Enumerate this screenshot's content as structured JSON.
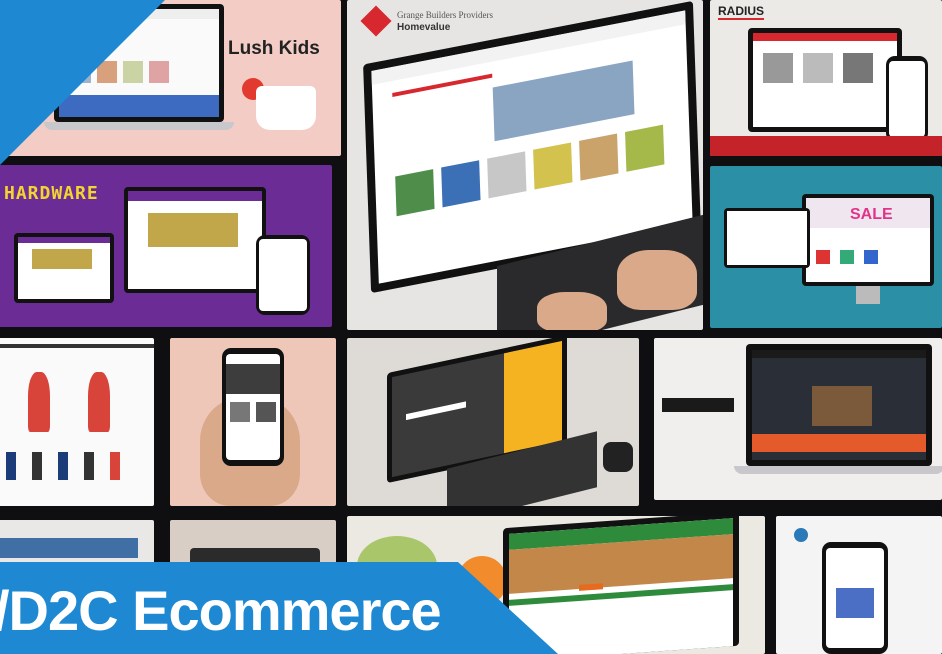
{
  "tiles": {
    "lush_kids": {
      "brand": "Lush Kids"
    },
    "homevalue": {
      "line1": "Grange Builders Providers",
      "line2": "Homevalue"
    },
    "radius": {
      "brand": "RADIUS"
    },
    "hardware": {
      "brand": "HARDWARE"
    },
    "grocery": {
      "sale_badge": "SALE"
    }
  },
  "banner": {
    "text": "/D2C Ecommerce"
  },
  "colors": {
    "banner_blue": "#1e88d2",
    "hardware_purple": "#6b2c95",
    "teal": "#2b8fa5",
    "pink": "#f4c9c3"
  }
}
